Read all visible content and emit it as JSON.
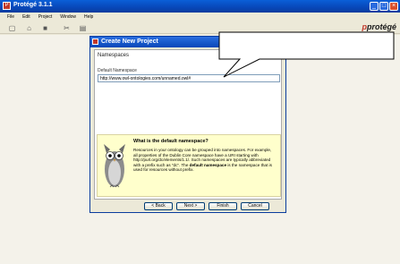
{
  "window": {
    "title": "Protégé 3.1.1",
    "logo_text": "protégé"
  },
  "menu": [
    "File",
    "Edit",
    "Project",
    "Window",
    "Help"
  ],
  "dialog": {
    "title": "Create New Project",
    "section": "Namespaces",
    "field_label": "Default Namespace",
    "field_value": "http://www.owl-ontologies.com/unnamed.owl#",
    "help_title": "What is the default namespace?",
    "help_text_1": "Resources in your ontology can be grouped into namespaces. For example, all properties of the Dublin Core namespace have a URI starting with http://purl.org/dc/elements/1.1/. Such namespaces are typically abbreviated with a prefix such as \"dc\". The ",
    "help_bold": "default namespace",
    "help_text_2": " is the namespace that is used for resources without prefix.",
    "buttons": {
      "back": "< Back",
      "next": "Next >",
      "finish": "Finish",
      "cancel": "Cancel"
    }
  },
  "colors": {
    "titlebar": "#0847b8",
    "help_background": "#ffffcc"
  }
}
